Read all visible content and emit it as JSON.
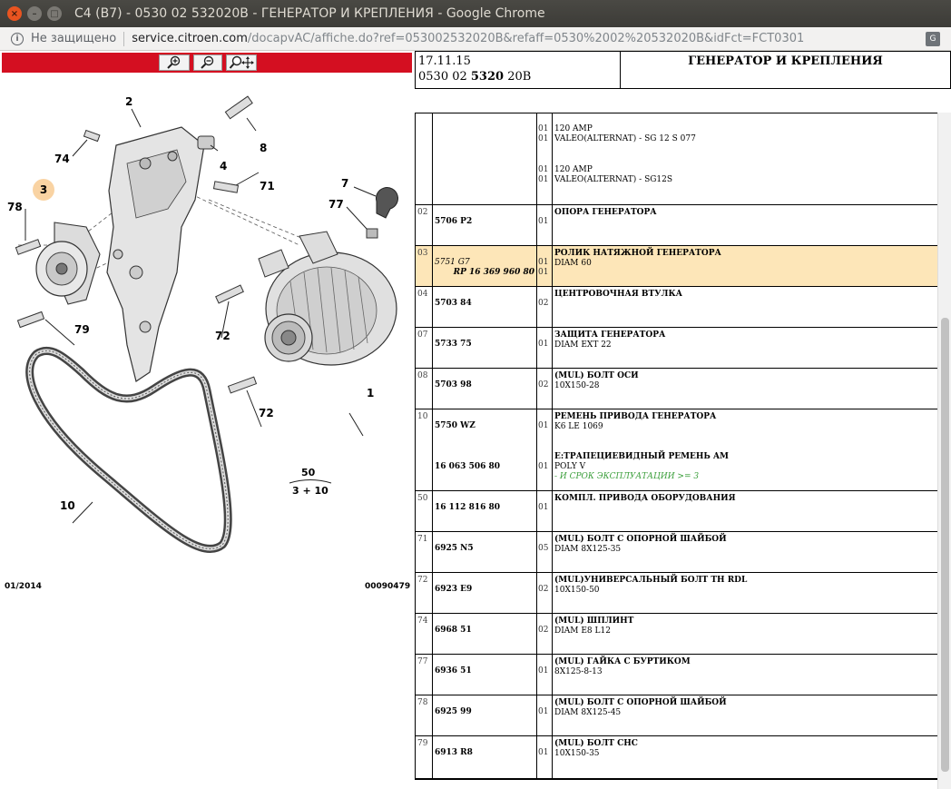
{
  "window": {
    "title": "C4 (B7) - 0530 02 532020B - ГЕНЕРАТОР И КРЕПЛЕНИЯ - Google Chrome"
  },
  "address_bar": {
    "security_label": "Не защищено",
    "url_host": "service.citroen.com",
    "url_path": "/docapvAC/affiche.do?ref=053002532020B&refaff=0530%2002%20532020B&idFct=FCT0301"
  },
  "icons": {
    "zoom_in": "zoom-in-icon",
    "zoom_out": "zoom-out-icon",
    "zoom_pan": "zoom-pan-icon",
    "info": "info-icon",
    "translate": "translate-icon"
  },
  "colors": {
    "toolbar_red": "#d40f21",
    "highlight_row": "#fde6b8",
    "callout_highlight": "#f9d3a3",
    "note_green": "#3a9e3a"
  },
  "diagram": {
    "date": "01/2014",
    "code": "00090479",
    "callouts": [
      "2",
      "8",
      "4",
      "74",
      "71",
      "3",
      "78",
      "7",
      "77",
      "79",
      "72",
      "72",
      "1",
      "10"
    ],
    "ratio_top": "50",
    "ratio_bottom": "3 + 10"
  },
  "header": {
    "date": "17.11.15",
    "ref_prefix": "0530 02 ",
    "ref_bold": "5320",
    "ref_suffix": " 20B",
    "title": "ГЕНЕРАТОР И КРЕПЛЕНИЯ"
  },
  "rows": [
    {
      "num": "",
      "ref": "",
      "qty1": "01",
      "qty2": "01",
      "qty3": "01",
      "qty4": "01",
      "d1": "120 AMP",
      "d2": "VALEO(ALTERNAT) - SG 12 S 077",
      "d3": "120 AMP",
      "d4": "VALEO(ALTERNAT) - SG12S"
    },
    {
      "num": "02",
      "ref": "5706 P2",
      "qty": "01",
      "title": "ОПОРА ГЕНЕРАТОРА",
      "desc": ""
    },
    {
      "num": "03",
      "ref": "5751 G7",
      "ref2": "RP 16 369 960 80",
      "qty": "01",
      "qty2": "01",
      "title": "РОЛИК НАТЯЖНОЙ ГЕНЕРАТОРА",
      "desc": "DIAM 60"
    },
    {
      "num": "04",
      "ref": "5703 84",
      "qty": "02",
      "title": "ЦЕНТРОВОЧНАЯ ВТУЛКА",
      "desc": ""
    },
    {
      "num": "07",
      "ref": "5733 75",
      "qty": "01",
      "title": "ЗАЩИТА ГЕНЕРАТОРА",
      "desc": "DIAM EXT 22"
    },
    {
      "num": "08",
      "ref": "5703 98",
      "qty": "02",
      "title": "(MUL) БОЛТ ОСИ",
      "desc": "10X150-28"
    },
    {
      "num": "10",
      "ref": "5750 WZ",
      "qty": "01",
      "title": "РЕМЕНЬ ПРИВОДА ГЕНЕРАТОРА",
      "desc": "K6 LE 1069",
      "ref2": "16 063 506 80",
      "qty2": "01",
      "title2": "E:ТРАПЕЦИЕВИДНЫЙ РЕМЕНЬ AM",
      "desc2": "POLY V",
      "note": "- И СРОК ЭКСПЛУАТАЦИИ >= 3"
    },
    {
      "num": "50",
      "ref": "16 112 816 80",
      "qty": "01",
      "title": "КОМПЛ. ПРИВОДА ОБОРУДОВАНИЯ",
      "desc": ""
    },
    {
      "num": "71",
      "ref": "6925 N5",
      "qty": "05",
      "title": "(MUL) БОЛТ С ОПОРНОЙ ШАЙБОЙ",
      "desc": "DIAM 8X125-35"
    },
    {
      "num": "72",
      "ref": "6923 E9",
      "qty": "02",
      "title": "(MUL)УНИВЕРСАЛЬНЫЙ БОЛТ TH RDL",
      "desc": "10X150-50"
    },
    {
      "num": "74",
      "ref": "6968 51",
      "qty": "02",
      "title": "(MUL) ШПЛИНТ",
      "desc": "DIAM E8 L12"
    },
    {
      "num": "77",
      "ref": "6936 51",
      "qty": "01",
      "title": "(MUL) ГАЙКА С БУРТИКОМ",
      "desc": "8X125-8-13"
    },
    {
      "num": "78",
      "ref": "6925 99",
      "qty": "01",
      "title": "(MUL) БОЛТ С ОПОРНОЙ ШАЙБОЙ",
      "desc": "DIAM 8X125-45"
    },
    {
      "num": "79",
      "ref": "6913 R8",
      "qty": "01",
      "title": "(MUL) БОЛТ CHC",
      "desc": "10X150-35"
    }
  ]
}
